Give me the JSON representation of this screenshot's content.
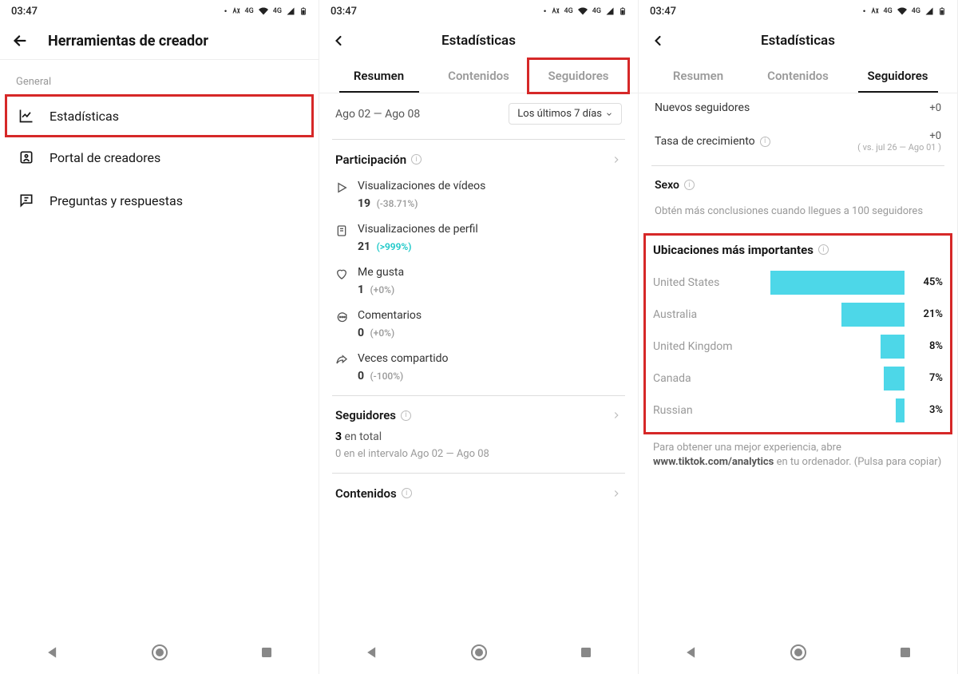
{
  "statusbar": {
    "time": "03:47",
    "net_label": "4G"
  },
  "phone1": {
    "title": "Herramientas de creador",
    "section": "General",
    "items": [
      {
        "label": "Estadísticas",
        "boxed": true
      },
      {
        "label": "Portal de creadores",
        "boxed": false
      },
      {
        "label": "Preguntas y respuestas",
        "boxed": false
      }
    ]
  },
  "phone2": {
    "title": "Estadísticas",
    "tabs": [
      "Resumen",
      "Contenidos",
      "Seguidores"
    ],
    "active_tab": 0,
    "highlighted_tab": 2,
    "date_range": "Ago 02 — Ago 08",
    "date_pill": "Los últimos 7 días",
    "participation": {
      "title": "Participación",
      "metrics": [
        {
          "icon": "play",
          "label": "Visualizaciones de vídeos",
          "value": "19",
          "delta": "(-38.71%)",
          "pos": false
        },
        {
          "icon": "profile",
          "label": "Visualizaciones de perfil",
          "value": "21",
          "delta": "(>999%)",
          "pos": true
        },
        {
          "icon": "heart",
          "label": "Me gusta",
          "value": "1",
          "delta": "(+0%)",
          "pos": false
        },
        {
          "icon": "comment",
          "label": "Comentarios",
          "value": "0",
          "delta": "(+0%)",
          "pos": false
        },
        {
          "icon": "share",
          "label": "Veces compartido",
          "value": "0",
          "delta": "(-100%)",
          "pos": false
        }
      ]
    },
    "followers": {
      "title": "Seguidores",
      "total_value": "3",
      "total_suffix": "en total",
      "note": "0 en el intervalo Ago 02 — Ago 08"
    },
    "contents_title": "Contenidos"
  },
  "phone3": {
    "title": "Estadísticas",
    "tabs": [
      "Resumen",
      "Contenidos",
      "Seguidores"
    ],
    "active_tab": 2,
    "rows": [
      {
        "label": "Nuevos seguidores",
        "value": "+0",
        "sub": ""
      },
      {
        "label": "Tasa de crecimiento",
        "value": "+0",
        "sub": "( vs. jul 26 — Ago 01 )"
      }
    ],
    "gender": {
      "label": "Sexo",
      "hint": "Obtén más conclusiones cuando llegues a 100 seguidores"
    },
    "locations": {
      "title": "Ubicaciones más importantes",
      "footer_pre": "Para obtener una mejor experiencia, abre ",
      "footer_bold": "www.tiktok.com/analytics",
      "footer_post": " en tu ordenador. (Pulsa para copiar)"
    }
  },
  "chart_data": {
    "type": "bar",
    "title": "Ubicaciones más importantes",
    "orientation": "horizontal",
    "unit": "%",
    "categories": [
      "United States",
      "Australia",
      "United Kingdom",
      "Canada",
      "Russian"
    ],
    "values": [
      45,
      21,
      8,
      7,
      3
    ],
    "xlim": [
      0,
      50
    ],
    "color": "#4dd7e8"
  }
}
